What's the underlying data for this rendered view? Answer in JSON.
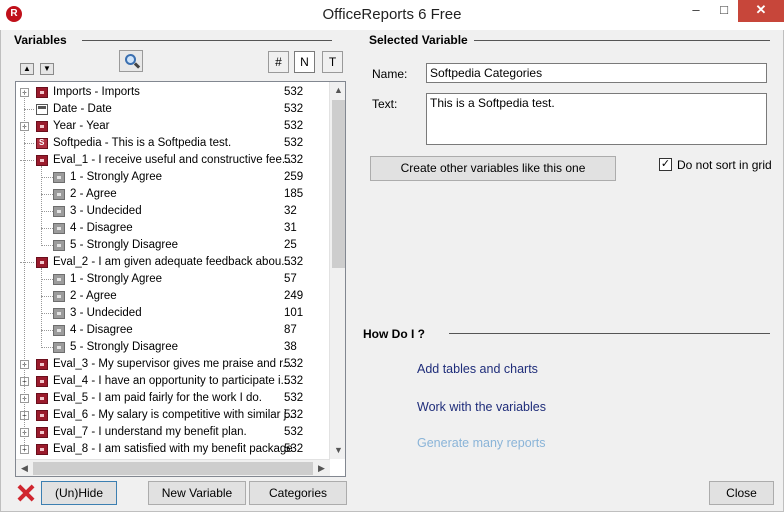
{
  "window": {
    "title": "OfficeReports 6 Free",
    "icon": "officereports-logo-icon",
    "controls": [
      "minimize",
      "maximize",
      "close"
    ]
  },
  "left": {
    "header": "Variables",
    "count_toggles": [
      "#",
      "N",
      "T"
    ],
    "active_toggle": "N",
    "tree": [
      {
        "label": "Imports - Imports",
        "count": "532",
        "icon": "var",
        "level": 0,
        "expand": true
      },
      {
        "label": "Date - Date",
        "count": "532",
        "icon": "date",
        "level": 0,
        "expand": false
      },
      {
        "label": "Year - Year",
        "count": "532",
        "icon": "var",
        "level": 0,
        "expand": true
      },
      {
        "label": "Softpedia - This is a Softpedia test.",
        "count": "532",
        "icon": "str",
        "level": 0,
        "expand": false
      },
      {
        "label": "Eval_1 - I receive useful and constructive fee...",
        "count": "532",
        "icon": "var",
        "level": 0,
        "expand": false,
        "expanded": true
      },
      {
        "label": "1 - Strongly Agree",
        "count": "259",
        "icon": "val",
        "level": 1
      },
      {
        "label": "2 - Agree",
        "count": "185",
        "icon": "val",
        "level": 1
      },
      {
        "label": "3 - Undecided",
        "count": "32",
        "icon": "val",
        "level": 1
      },
      {
        "label": "4 - Disagree",
        "count": "31",
        "icon": "val",
        "level": 1
      },
      {
        "label": "5 - Strongly Disagree",
        "count": "25",
        "icon": "val",
        "level": 1
      },
      {
        "label": "Eval_2 - I am given adequate feedback abou...",
        "count": "532",
        "icon": "var",
        "level": 0,
        "expand": false,
        "expanded": true
      },
      {
        "label": "1 - Strongly Agree",
        "count": "57",
        "icon": "val",
        "level": 1
      },
      {
        "label": "2 - Agree",
        "count": "249",
        "icon": "val",
        "level": 1
      },
      {
        "label": "3 - Undecided",
        "count": "101",
        "icon": "val",
        "level": 1
      },
      {
        "label": "4 - Disagree",
        "count": "87",
        "icon": "val",
        "level": 1
      },
      {
        "label": "5 - Strongly Disagree",
        "count": "38",
        "icon": "val",
        "level": 1
      },
      {
        "label": "Eval_3 - My supervisor gives me praise and r...",
        "count": "532",
        "icon": "var",
        "level": 0,
        "expand": true
      },
      {
        "label": "Eval_4 - I have an opportunity to participate i...",
        "count": "532",
        "icon": "var",
        "level": 0,
        "expand": true
      },
      {
        "label": "Eval_5 - I am paid fairly for the work I do.",
        "count": "532",
        "icon": "var",
        "level": 0,
        "expand": true
      },
      {
        "label": "Eval_6 - My salary is competitive with similar j...",
        "count": "532",
        "icon": "var",
        "level": 0,
        "expand": true
      },
      {
        "label": "Eval_7 - I understand my benefit plan.",
        "count": "532",
        "icon": "var",
        "level": 0,
        "expand": true
      },
      {
        "label": "Eval_8 - I am satisfied with my benefit package",
        "count": "532",
        "icon": "var",
        "level": 0,
        "expand": true
      }
    ],
    "buttons": {
      "unhide": "(Un)Hide",
      "new_variable": "New Variable",
      "categories": "Categories"
    }
  },
  "right": {
    "header": "Selected Variable",
    "name_label": "Name:",
    "name_value": "Softpedia Categories",
    "text_label": "Text:",
    "text_value": "This is a Softpedia test.",
    "create_button": "Create other variables like this one",
    "do_not_sort_label": "Do not sort in grid",
    "do_not_sort_checked": true,
    "howdo_header": "How Do I ?",
    "links": [
      "Add tables and charts",
      "Work with the variables",
      "Generate many reports"
    ],
    "close_button": "Close"
  }
}
